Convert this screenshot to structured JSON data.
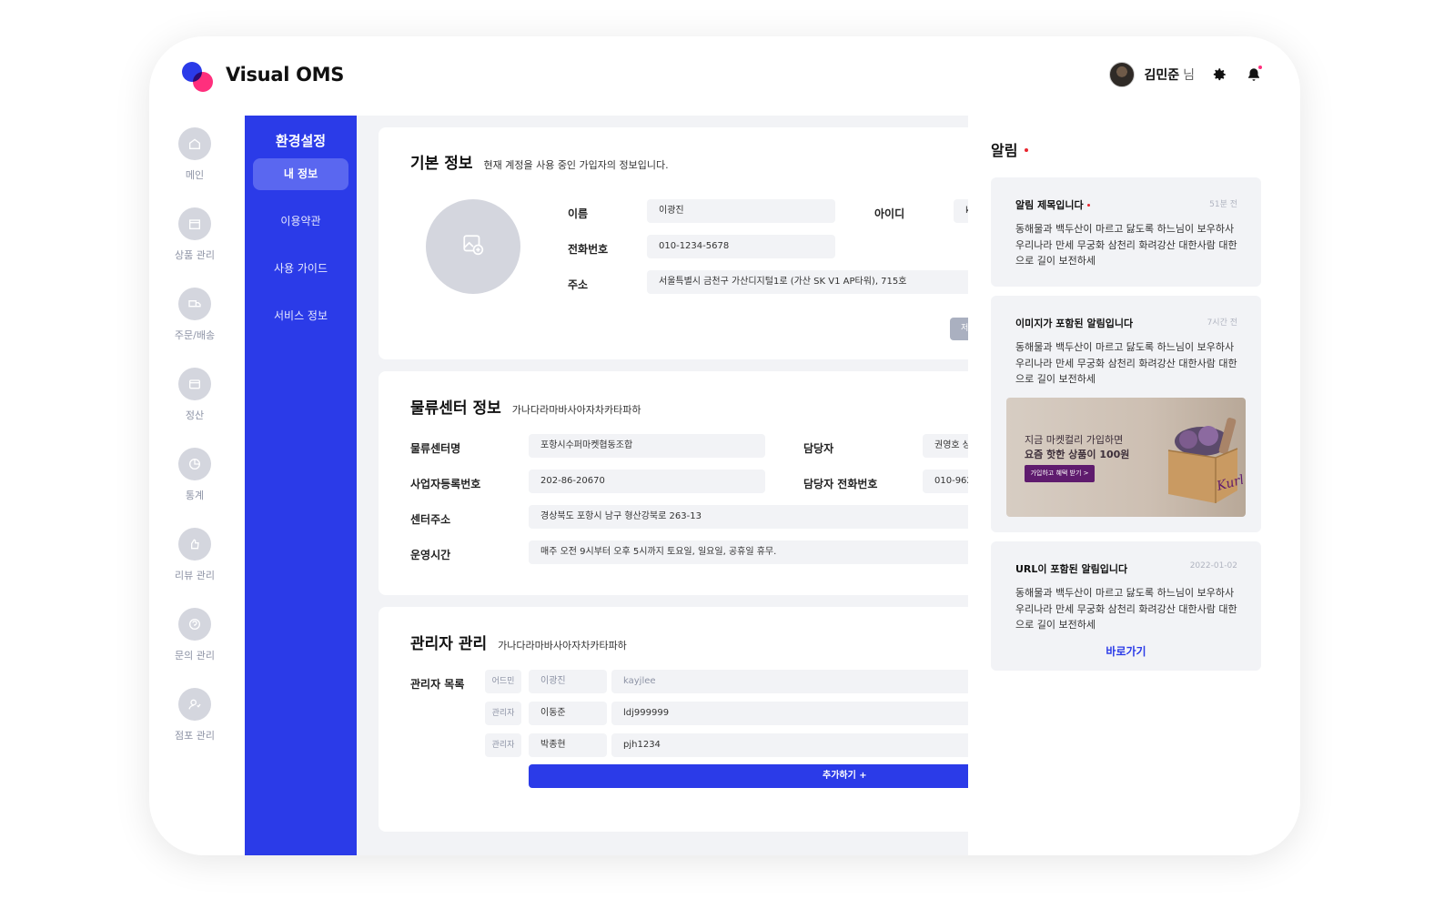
{
  "header": {
    "app_title": "Visual OMS",
    "user_name": "김민준",
    "user_suffix": "님"
  },
  "left_nav": {
    "items": [
      {
        "label": "메인",
        "icon": "home-icon"
      },
      {
        "label": "상품 관리",
        "icon": "box-icon"
      },
      {
        "label": "주문/배송",
        "icon": "truck-icon"
      },
      {
        "label": "정산",
        "icon": "wallet-icon"
      },
      {
        "label": "통계",
        "icon": "chart-icon"
      },
      {
        "label": "리뷰 관리",
        "icon": "review-icon"
      },
      {
        "label": "문의 관리",
        "icon": "inquiry-icon"
      },
      {
        "label": "점포 관리",
        "icon": "store-icon"
      }
    ]
  },
  "settings": {
    "title": "환경설정",
    "items": [
      {
        "label": "내 정보"
      },
      {
        "label": "이용약관"
      },
      {
        "label": "사용 가이드"
      },
      {
        "label": "서비스 정보"
      }
    ]
  },
  "basic_info": {
    "title": "기본 정보",
    "subtitle": "현재 계정을 사용 중인 가입자의 정보입니다.",
    "name_label": "이름",
    "name_value": "이광진",
    "id_label": "아이디",
    "id_value": "k",
    "phone_label": "전화번호",
    "phone_value": "010-1234-5678",
    "address_label": "주소",
    "address_value": "서울특별시 금천구 가산디지털1로 (가산 SK V1 AP타워), 715호",
    "save_label": "저"
  },
  "logistics": {
    "title": "물류센터 정보",
    "subtitle": "가나다라마바사아자차카타파하",
    "center_name_label": "물류센터명",
    "center_name_value": "포항시수퍼마켓협동조합",
    "manager_label": "담당자",
    "manager_value": "권영호 상",
    "biz_no_label": "사업자등록번호",
    "biz_no_value": "202-86-20670",
    "manager_phone_label": "담당자 전화번호",
    "manager_phone_value": "010-962",
    "address_label": "센터주소",
    "address_value": "경상북도 포항시 남구 형산강북로 263-13",
    "hours_label": "운영시간",
    "hours_value": "매주 오전 9시부터 오후 5시까지 토요일, 일요일, 공휴일 휴무."
  },
  "admins": {
    "title": "관리자 관리",
    "subtitle": "가나다라마바사아자차카타파하",
    "list_label": "관리자 목록",
    "rows": [
      {
        "role": "어드민",
        "name": "이광진",
        "id": "kayjlee"
      },
      {
        "role": "관리자",
        "name": "이동준",
        "id": "ldj999999"
      },
      {
        "role": "관리자",
        "name": "박종현",
        "id": "pjh1234"
      }
    ],
    "add_label": "추가하기 +"
  },
  "notifications": {
    "title": "알림",
    "items": [
      {
        "title": "알림 제목입니다",
        "time": "51분 전",
        "body": "동해물과 백두산이 마르고 닳도록 하느님이 보우하사 우리나라 만세 무궁화 삼천리 화려강산 대한사람 대한으로 길이 보전하세"
      },
      {
        "title": "이미지가 포함된 알림입니다",
        "time": "7시간 전",
        "body": "동해물과 백두산이 마르고 닳도록 하느님이 보우하사 우리나라 만세 무궁화 삼천리 화려강산 대한사람 대한으로 길이 보전하세",
        "banner": {
          "line1": "지금 마켓컬리 가입하면",
          "line2": "요즘 핫한 상품이 100원",
          "button": "가입하고 혜택 받기 >",
          "brand": "Kurly"
        }
      },
      {
        "title": "URL이 포함된 알림입니다",
        "time": "2022-01-02",
        "body": "동해물과 백두산이 마르고 닳도록 하느님이 보우하사 우리나라 만세 무궁화 삼천리 화려강산 대한사람 대한으로 길이 보전하세",
        "link_label": "바로가기"
      }
    ]
  },
  "colors": {
    "primary": "#2b3be8",
    "accent_pink": "#ff2f7d",
    "nav_icon_bg": "#d4d6de",
    "field_bg": "#f2f3f6",
    "unread_dot": "#e8262f"
  }
}
